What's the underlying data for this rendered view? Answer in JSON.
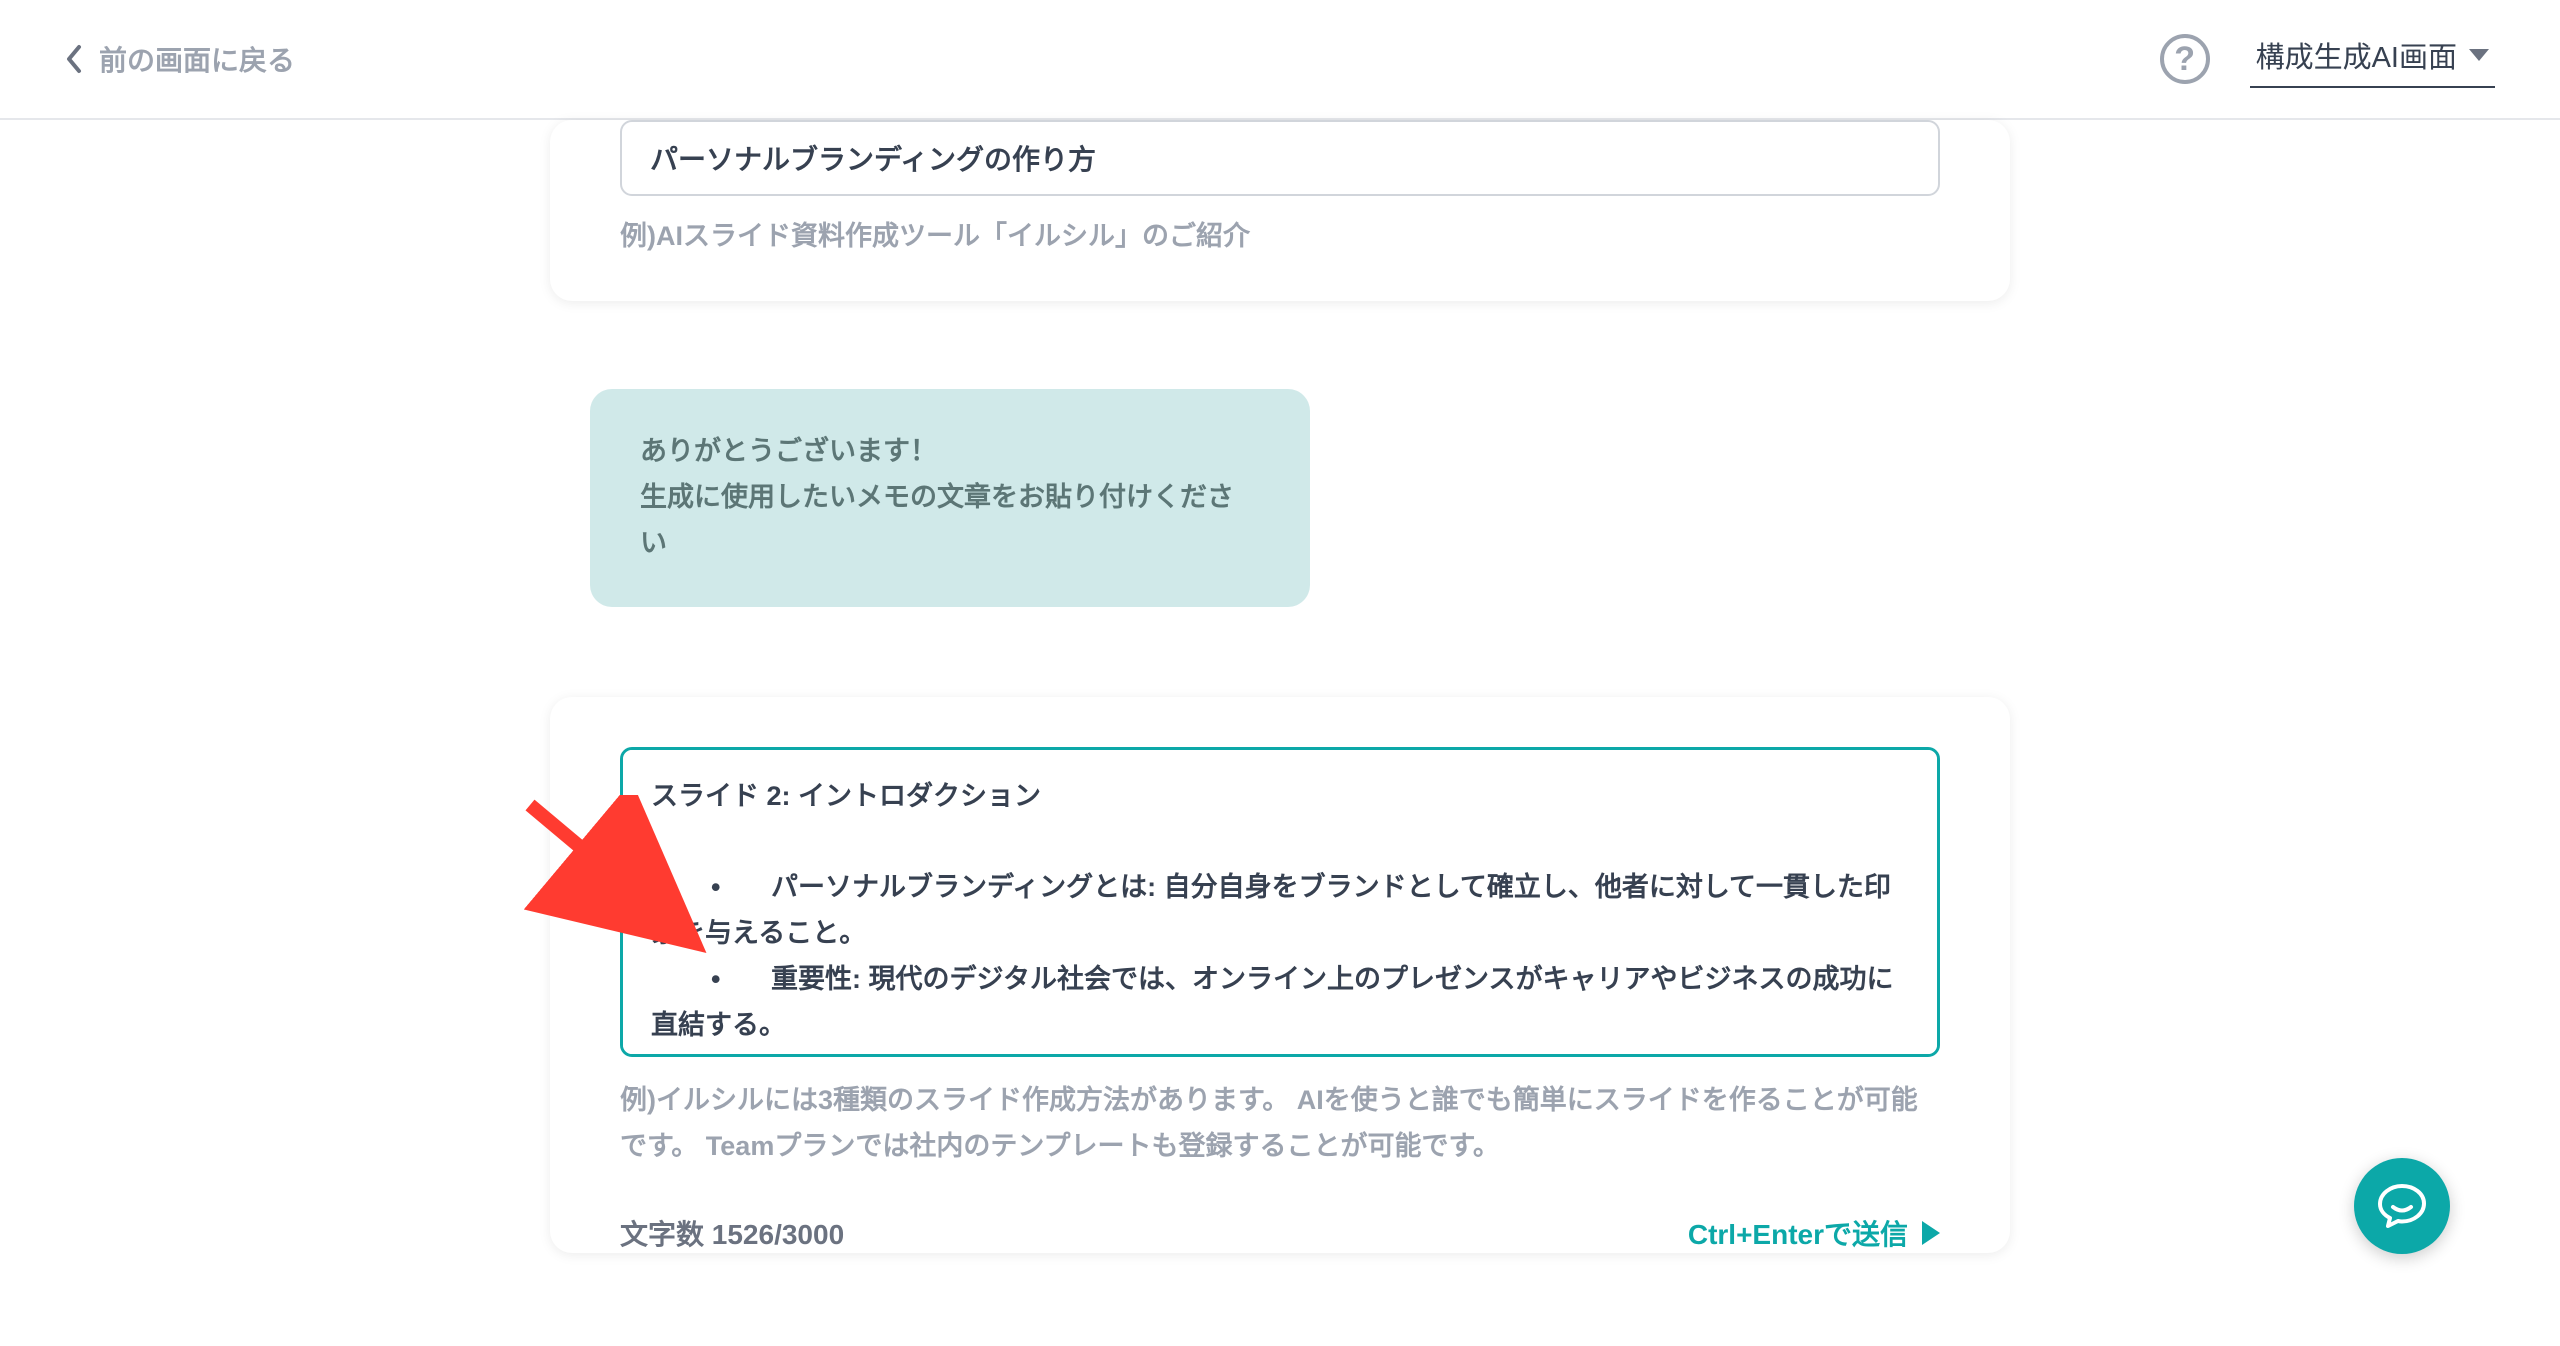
{
  "header": {
    "back_label": "前の画面に戻る",
    "help_label": "?",
    "screen_selector_label": "構成生成AI画面"
  },
  "title_card": {
    "input_value": "パーソナルブランディングの作り方",
    "example_text": "例)AIスライド資料作成ツール「イルシル」のご紹介"
  },
  "ai_message": {
    "line1": "ありがとうございます！",
    "line2": "生成に使用したいメモの文章をお貼り付けください"
  },
  "memo_card": {
    "textarea_value": "スライド 2: イントロダクション\n\n\t•\tパーソナルブランディングとは: 自分自身をブランドとして確立し、他者に対して一貫した印象を与えること。\n\t•\t重要性: 現代のデジタル社会では、オンライン上のプレゼンスがキャリアやビジネスの成功に直結する。\n\t•\t目的: 自分の強みを明確にし、ターゲットオーディエンスに効果的にアピールすること。",
    "example_text": "例)イルシルには3種類のスライド作成方法があります。 AIを使うと誰でも簡単にスライドを作ることが可能です。 Teamプランでは社内のテンプレートも登録することが可能です。",
    "char_count_label": "文字数 1526/3000",
    "submit_label": "Ctrl+Enterで送信"
  },
  "colors": {
    "accent": "#0ca8a8",
    "bubble_bg": "#d0e9e9",
    "muted": "#9ca3af",
    "arrow": "#ff3b30"
  }
}
